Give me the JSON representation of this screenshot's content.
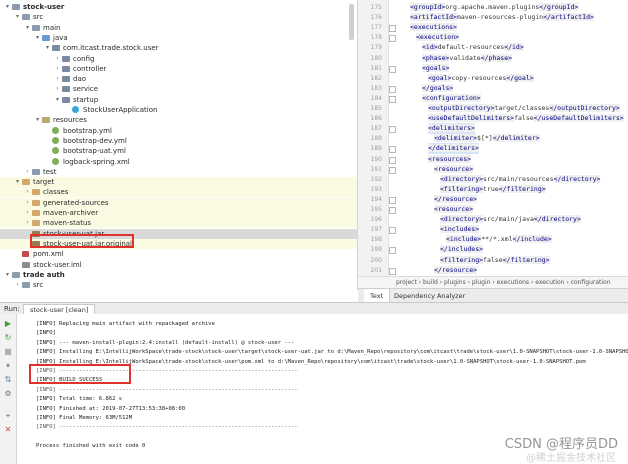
{
  "tree": {
    "rows": [
      {
        "label": "stock-user",
        "depth": 0,
        "arrow": "▾",
        "icon": "folder",
        "bold": true
      },
      {
        "label": "src",
        "depth": 1,
        "arrow": "▾",
        "icon": "folder"
      },
      {
        "label": "main",
        "depth": 2,
        "arrow": "▾",
        "icon": "folder"
      },
      {
        "label": "java",
        "depth": 3,
        "arrow": "▾",
        "icon": "folder-src"
      },
      {
        "label": "com.itcast.trade.stock.user",
        "depth": 4,
        "arrow": "▾",
        "icon": "pkg"
      },
      {
        "label": "config",
        "depth": 5,
        "arrow": "›",
        "icon": "pkg"
      },
      {
        "label": "controller",
        "depth": 5,
        "arrow": "›",
        "icon": "pkg"
      },
      {
        "label": "dao",
        "depth": 5,
        "arrow": "›",
        "icon": "pkg"
      },
      {
        "label": "service",
        "depth": 5,
        "arrow": "›",
        "icon": "pkg"
      },
      {
        "label": "startup",
        "depth": 5,
        "arrow": "▾",
        "icon": "pkg"
      },
      {
        "label": "StockUserApplication",
        "depth": 6,
        "arrow": "",
        "icon": "cls"
      },
      {
        "label": "resources",
        "depth": 3,
        "arrow": "▾",
        "icon": "folder-res"
      },
      {
        "label": "bootstrap.yml",
        "depth": 4,
        "arrow": "",
        "icon": "yml"
      },
      {
        "label": "bootstrap-dev.yml",
        "depth": 4,
        "arrow": "",
        "icon": "yml"
      },
      {
        "label": "bootstrap-uat.yml",
        "depth": 4,
        "arrow": "",
        "icon": "yml"
      },
      {
        "label": "logback-spring.xml",
        "depth": 4,
        "arrow": "",
        "icon": "yml"
      },
      {
        "label": "test",
        "depth": 2,
        "arrow": "›",
        "icon": "folder"
      },
      {
        "label": "target",
        "depth": 1,
        "arrow": "▾",
        "icon": "folder-gen",
        "yellow": true
      },
      {
        "label": "classes",
        "depth": 2,
        "arrow": "›",
        "icon": "folder-gen",
        "yellow": true
      },
      {
        "label": "generated-sources",
        "depth": 2,
        "arrow": "›",
        "icon": "folder-gen",
        "yellow": true
      },
      {
        "label": "maven-archiver",
        "depth": 2,
        "arrow": "›",
        "icon": "folder-gen",
        "yellow": true
      },
      {
        "label": "maven-status",
        "depth": 2,
        "arrow": "›",
        "icon": "folder-gen",
        "yellow": true
      },
      {
        "label": "stock-user-uat.jar",
        "depth": 2,
        "arrow": "",
        "icon": "jar",
        "selected": true
      },
      {
        "label": "stock-user-uat.jar.original",
        "depth": 2,
        "arrow": "",
        "icon": "jar",
        "yellow": true
      },
      {
        "label": "pom.xml",
        "depth": 1,
        "arrow": "",
        "icon": "pom"
      },
      {
        "label": "stock-user.iml",
        "depth": 1,
        "arrow": "",
        "icon": "iml"
      },
      {
        "label": "trade auth",
        "depth": 0,
        "arrow": "▾",
        "icon": "folder",
        "bold": true
      },
      {
        "label": "src",
        "depth": 1,
        "arrow": "›",
        "icon": "folder"
      }
    ]
  },
  "editor": {
    "lines": [
      {
        "num": "175",
        "indent": 2,
        "html": [
          {
            "t": "tag",
            "v": "<groupId>"
          },
          {
            "t": "txt",
            "v": "org.apache.maven.plugins"
          },
          {
            "t": "tag",
            "v": "</groupId>"
          }
        ]
      },
      {
        "num": "176",
        "indent": 2,
        "html": [
          {
            "t": "tag",
            "v": "<artifactId>"
          },
          {
            "t": "txt",
            "v": "maven-resources-plugin"
          },
          {
            "t": "tag",
            "v": "</artifactId>"
          }
        ]
      },
      {
        "num": "177",
        "indent": 2,
        "html": [
          {
            "t": "tag",
            "v": "<executions>"
          }
        ],
        "fold": true
      },
      {
        "num": "178",
        "indent": 3,
        "html": [
          {
            "t": "tag",
            "v": "<execution>"
          }
        ],
        "fold": true
      },
      {
        "num": "179",
        "indent": 4,
        "html": [
          {
            "t": "tag",
            "v": "<id>"
          },
          {
            "t": "txt",
            "v": "default-resources"
          },
          {
            "t": "tag",
            "v": "</id>"
          }
        ]
      },
      {
        "num": "180",
        "indent": 4,
        "html": [
          {
            "t": "tag",
            "v": "<phase>"
          },
          {
            "t": "txt",
            "v": "validate"
          },
          {
            "t": "tag",
            "v": "</phase>"
          }
        ]
      },
      {
        "num": "181",
        "indent": 4,
        "html": [
          {
            "t": "tag",
            "v": "<goals>"
          }
        ],
        "fold": true
      },
      {
        "num": "182",
        "indent": 5,
        "html": [
          {
            "t": "tag",
            "v": "<goal>"
          },
          {
            "t": "txt",
            "v": "copy-resources"
          },
          {
            "t": "tag",
            "v": "</goal>"
          }
        ]
      },
      {
        "num": "183",
        "indent": 4,
        "html": [
          {
            "t": "tag",
            "v": "</goals>"
          }
        ],
        "fold": true
      },
      {
        "num": "184",
        "indent": 4,
        "html": [
          {
            "t": "tag",
            "v": "<configuration>"
          }
        ],
        "fold": true
      },
      {
        "num": "185",
        "indent": 5,
        "html": [
          {
            "t": "tag",
            "v": "<outputDirectory>"
          },
          {
            "t": "txt",
            "v": "target/classes"
          },
          {
            "t": "tag",
            "v": "</outputDirectory>"
          }
        ]
      },
      {
        "num": "186",
        "indent": 5,
        "html": [
          {
            "t": "tag",
            "v": "<useDefaultDelimiters>"
          },
          {
            "t": "txt",
            "v": "false"
          },
          {
            "t": "tag",
            "v": "</useDefaultDelimiters>"
          }
        ]
      },
      {
        "num": "187",
        "indent": 5,
        "html": [
          {
            "t": "tag",
            "v": "<delimiters>"
          }
        ],
        "fold": true,
        "hl": true
      },
      {
        "num": "188",
        "indent": 6,
        "html": [
          {
            "t": "tag",
            "v": "<delimiter>"
          },
          {
            "t": "txt",
            "v": "$[*]"
          },
          {
            "t": "tag",
            "v": "</delimiter>"
          }
        ]
      },
      {
        "num": "189",
        "indent": 5,
        "html": [
          {
            "t": "tag",
            "v": "</delimiters>"
          }
        ],
        "fold": true,
        "hl": true
      },
      {
        "num": "190",
        "indent": 5,
        "html": [
          {
            "t": "tag",
            "v": "<resources>"
          }
        ],
        "fold": true
      },
      {
        "num": "191",
        "indent": 6,
        "html": [
          {
            "t": "tag",
            "v": "<resource>"
          }
        ],
        "fold": true
      },
      {
        "num": "192",
        "indent": 7,
        "html": [
          {
            "t": "tag",
            "v": "<directory>"
          },
          {
            "t": "txt",
            "v": "src/main/resources"
          },
          {
            "t": "tag",
            "v": "</directory>"
          }
        ]
      },
      {
        "num": "193",
        "indent": 7,
        "html": [
          {
            "t": "tag",
            "v": "<filtering>"
          },
          {
            "t": "txt",
            "v": "true"
          },
          {
            "t": "tag",
            "v": "</filtering>"
          }
        ]
      },
      {
        "num": "194",
        "indent": 6,
        "html": [
          {
            "t": "tag",
            "v": "</resource>"
          }
        ],
        "fold": true
      },
      {
        "num": "195",
        "indent": 6,
        "html": [
          {
            "t": "tag",
            "v": "<resource>"
          }
        ],
        "fold": true
      },
      {
        "num": "196",
        "indent": 7,
        "html": [
          {
            "t": "tag",
            "v": "<directory>"
          },
          {
            "t": "txt",
            "v": "src/main/java"
          },
          {
            "t": "tag",
            "v": "</directory>"
          }
        ]
      },
      {
        "num": "197",
        "indent": 7,
        "html": [
          {
            "t": "tag",
            "v": "<includes>"
          }
        ],
        "fold": true
      },
      {
        "num": "198",
        "indent": 8,
        "html": [
          {
            "t": "tag",
            "v": "<include>"
          },
          {
            "t": "txt",
            "v": "**/*.xml"
          },
          {
            "t": "tag",
            "v": "</include>"
          }
        ]
      },
      {
        "num": "199",
        "indent": 7,
        "html": [
          {
            "t": "tag",
            "v": "</includes>"
          }
        ],
        "fold": true
      },
      {
        "num": "200",
        "indent": 7,
        "html": [
          {
            "t": "tag",
            "v": "<filtering>"
          },
          {
            "t": "txt",
            "v": "false"
          },
          {
            "t": "tag",
            "v": "</filtering>"
          }
        ]
      },
      {
        "num": "201",
        "indent": 6,
        "html": [
          {
            "t": "tag",
            "v": "</resource>"
          }
        ],
        "fold": true
      }
    ],
    "breadcrumb": "project  ›  build  ›  plugins  ›  plugin  ›  executions  ›  execution  ›  configuration",
    "tabs": [
      "Text",
      "Dependency Analyzer"
    ]
  },
  "run": {
    "label": "Run:",
    "tab": "stock-user [clean]",
    "lines": [
      "[INFO] Replacing main artifact with repackaged archive",
      "[INFO]",
      "[INFO] --- maven-install-plugin:2.4:install (default-install) @ stock-user ---",
      "[INFO] Installing E:\\IntellijWorkSpace\\trade-stock\\stock-user\\target\\stock-user-uat.jar to d:\\Maven_Repo\\repository\\com\\itcast\\trade\\stock-user\\1.0-SNAPSHOT\\stock-user-1.0-SNAPSHOT.jar",
      "[INFO] Installing E:\\IntellijWorkSpace\\trade-stock\\stock-user\\pom.xml to d:\\Maven_Repo\\repository\\com\\itcast\\trade\\stock-user\\1.0-SNAPSHOT\\stock-user-1.0-SNAPSHOT.pom",
      "[INFO] ------------------------------------------------------------------------",
      "[INFO] BUILD SUCCESS",
      "[INFO] ------------------------------------------------------------------------",
      "[INFO] Total time:  6.862 s",
      "[INFO] Finished at: 2019-07-27T13:53:38+08:00",
      "[INFO] Final Memory: 63M/512M",
      "[INFO] ------------------------------------------------------------------------",
      "",
      "Process finished with exit code 0"
    ]
  },
  "watermark": "CSDN @程序员DD",
  "watermark_sub": "@稀土掘金技术社区"
}
